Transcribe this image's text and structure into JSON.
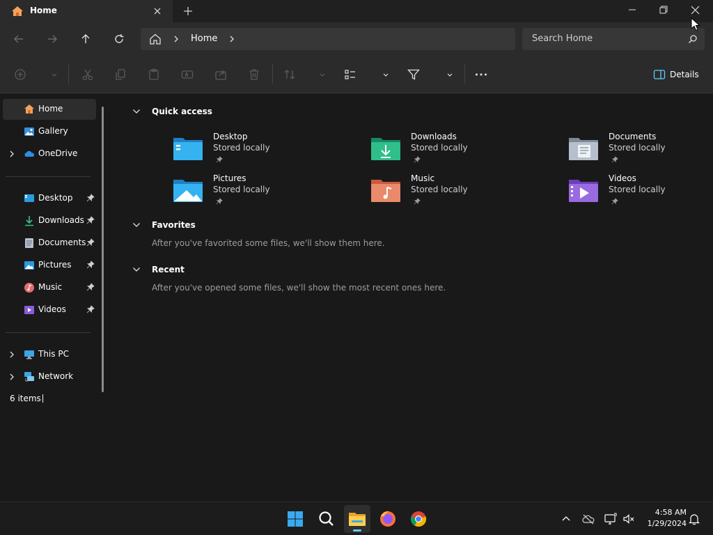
{
  "window": {
    "tab_title": "Home",
    "controls": [
      "minimize",
      "restore",
      "close"
    ]
  },
  "address": {
    "path": "Home",
    "search_placeholder": "Search Home"
  },
  "commandbar": {
    "details_label": "Details"
  },
  "sidebar": {
    "top_items": [
      {
        "label": "Home",
        "icon": "home-icon",
        "selected": true
      },
      {
        "label": "Gallery",
        "icon": "gallery-icon"
      },
      {
        "label": "OneDrive",
        "icon": "onedrive-icon",
        "expandable": true
      }
    ],
    "pinned_items": [
      {
        "label": "Desktop",
        "icon": "desktop-icon"
      },
      {
        "label": "Downloads",
        "icon": "downloads-icon"
      },
      {
        "label": "Documents",
        "icon": "documents-icon"
      },
      {
        "label": "Pictures",
        "icon": "pictures-icon"
      },
      {
        "label": "Music",
        "icon": "music-icon"
      },
      {
        "label": "Videos",
        "icon": "videos-icon"
      }
    ],
    "bottom_items": [
      {
        "label": "This PC",
        "icon": "this-pc-icon"
      },
      {
        "label": "Network",
        "icon": "network-icon"
      }
    ]
  },
  "status": {
    "items_count": "6 items"
  },
  "sections": {
    "quick_access": {
      "title": "Quick access",
      "tiles": [
        {
          "name": "Desktop",
          "sub": "Stored locally",
          "icon": "desktop-folder-icon"
        },
        {
          "name": "Downloads",
          "sub": "Stored locally",
          "icon": "downloads-folder-icon"
        },
        {
          "name": "Documents",
          "sub": "Stored locally",
          "icon": "documents-folder-icon"
        },
        {
          "name": "Pictures",
          "sub": "Stored locally",
          "icon": "pictures-folder-icon"
        },
        {
          "name": "Music",
          "sub": "Stored locally",
          "icon": "music-folder-icon"
        },
        {
          "name": "Videos",
          "sub": "Stored locally",
          "icon": "videos-folder-icon"
        }
      ]
    },
    "favorites": {
      "title": "Favorites",
      "message": "After you've favorited some files, we'll show them here."
    },
    "recent": {
      "title": "Recent",
      "message": "After you've opened some files, we'll show the most recent ones here."
    }
  },
  "taskbar": {
    "apps": [
      "start-icon",
      "search-icon",
      "file-explorer-icon",
      "firefox-icon",
      "chrome-icon"
    ],
    "time": "4:58 AM",
    "date": "1/29/2024"
  },
  "colors": {
    "accent": "#60cdff",
    "background": "#191919",
    "toolbar": "#2b2b2b"
  }
}
